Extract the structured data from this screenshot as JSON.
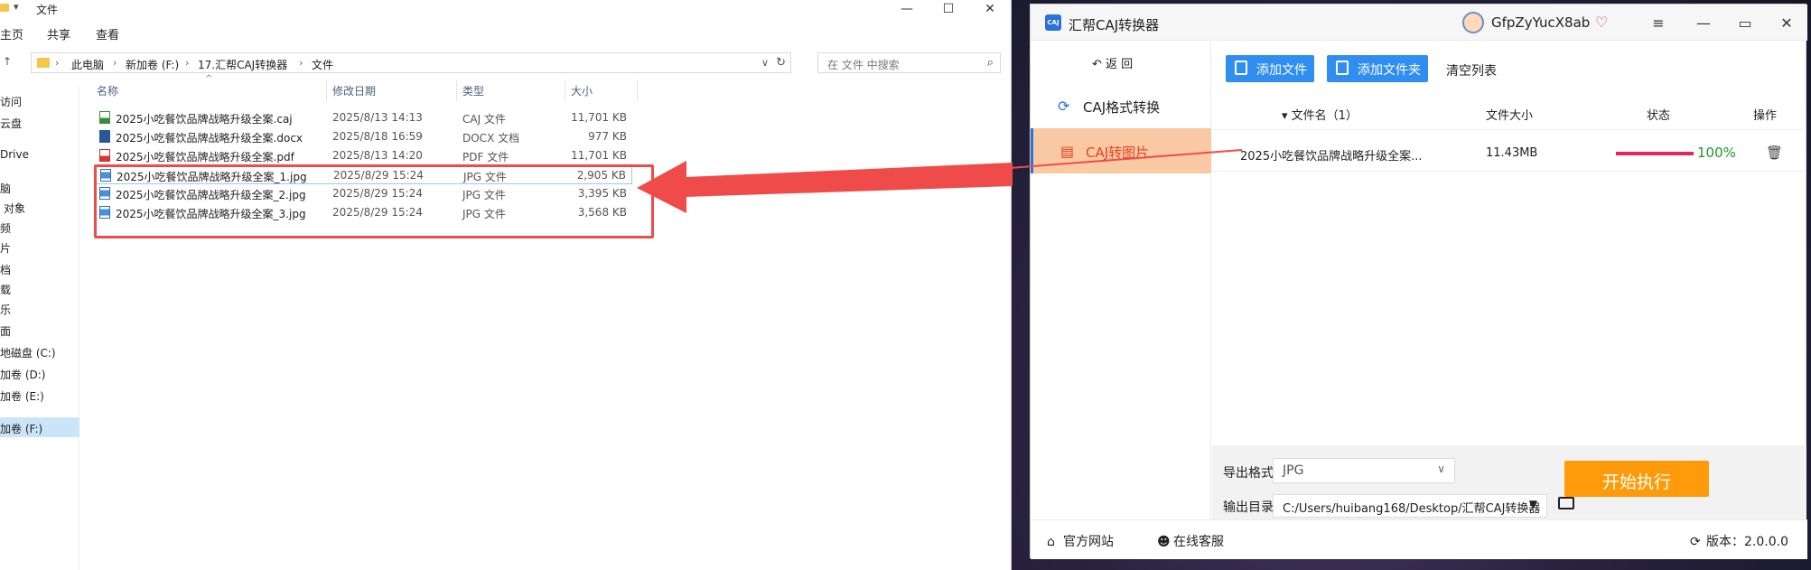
{
  "explorer": {
    "title": "文件",
    "ribbon_tabs": [
      "主页",
      "共享",
      "查看"
    ],
    "breadcrumb": [
      "此电脑",
      "新加卷 (F:)",
      "17.汇帮CAJ转换器",
      "文件"
    ],
    "search_placeholder": "在 文件 中搜索",
    "nav_items": [
      "访问",
      "云盘",
      "Drive",
      "脑",
      "对象",
      "频",
      "片",
      "档",
      "载",
      "乐",
      "面",
      "地磁盘 (C:)",
      "加卷 (D:)",
      "加卷 (E:)",
      "加卷 (F:)"
    ],
    "columns": {
      "name": "名称",
      "date": "修改日期",
      "type": "类型",
      "size": "大小"
    },
    "files": [
      {
        "name": "2025小吃餐饮品牌战略升级全案.caj",
        "date": "2025/8/13 14:13",
        "type": "CAJ 文件",
        "size": "11,701 KB",
        "icon": "caj-file-icon"
      },
      {
        "name": "2025小吃餐饮品牌战略升级全案.docx",
        "date": "2025/8/18 16:59",
        "type": "DOCX 文档",
        "size": "977 KB",
        "icon": "word-file-icon"
      },
      {
        "name": "2025小吃餐饮品牌战略升级全案.pdf",
        "date": "2025/8/13 14:20",
        "type": "PDF 文件",
        "size": "11,701 KB",
        "icon": "pdf-file-icon"
      },
      {
        "name": "2025小吃餐饮品牌战略升级全案_1.jpg",
        "date": "2025/8/29 15:24",
        "type": "JPG 文件",
        "size": "2,905 KB",
        "icon": "jpg-file-icon"
      },
      {
        "name": "2025小吃餐饮品牌战略升级全案_2.jpg",
        "date": "2025/8/29 15:24",
        "type": "JPG 文件",
        "size": "3,395 KB",
        "icon": "jpg-file-icon"
      },
      {
        "name": "2025小吃餐饮品牌战略升级全案_3.jpg",
        "date": "2025/8/29 15:24",
        "type": "JPG 文件",
        "size": "3,568 KB",
        "icon": "jpg-file-icon"
      }
    ]
  },
  "app": {
    "logo_text": "CAJ",
    "name": "汇帮CAJ转换器",
    "user": "GfpZyYucX8ab",
    "back_label": "返 回",
    "sidebar": [
      {
        "label": "CAJ格式转换",
        "active": false
      },
      {
        "label": "CAJ转图片",
        "active": true
      }
    ],
    "toolbar": {
      "add_file": "添加文件",
      "add_folder": "添加文件夹",
      "clear": "清空列表"
    },
    "table_header": {
      "name": "文件名（1）",
      "size": "文件大小",
      "status": "状态",
      "action": "操作"
    },
    "row": {
      "name": "2025小吃餐饮品牌战略升级全案...",
      "size": "11.43MB",
      "progress_text": "100%",
      "progress": 1.0
    },
    "export_format_label": "导出格式:",
    "export_format_value": "JPG",
    "output_dir_label": "输出目录:",
    "output_dir_value": "C:/Users/huibang168/Desktop/汇帮CAJ转换器",
    "start_button": "开始执行",
    "footer": {
      "website": "官方网站",
      "support": "在线客服",
      "version": "版本：2.0.0.0"
    }
  },
  "colors": {
    "highlight": "#ef4b4b",
    "primary_blue": "#2f8ef0",
    "start_orange": "#ff9b0a",
    "active_tab_bg": "#f8c9a2",
    "active_tab_text": "#e8431f",
    "progress": "#e8245d",
    "progress_text": "#1a9a2a"
  }
}
